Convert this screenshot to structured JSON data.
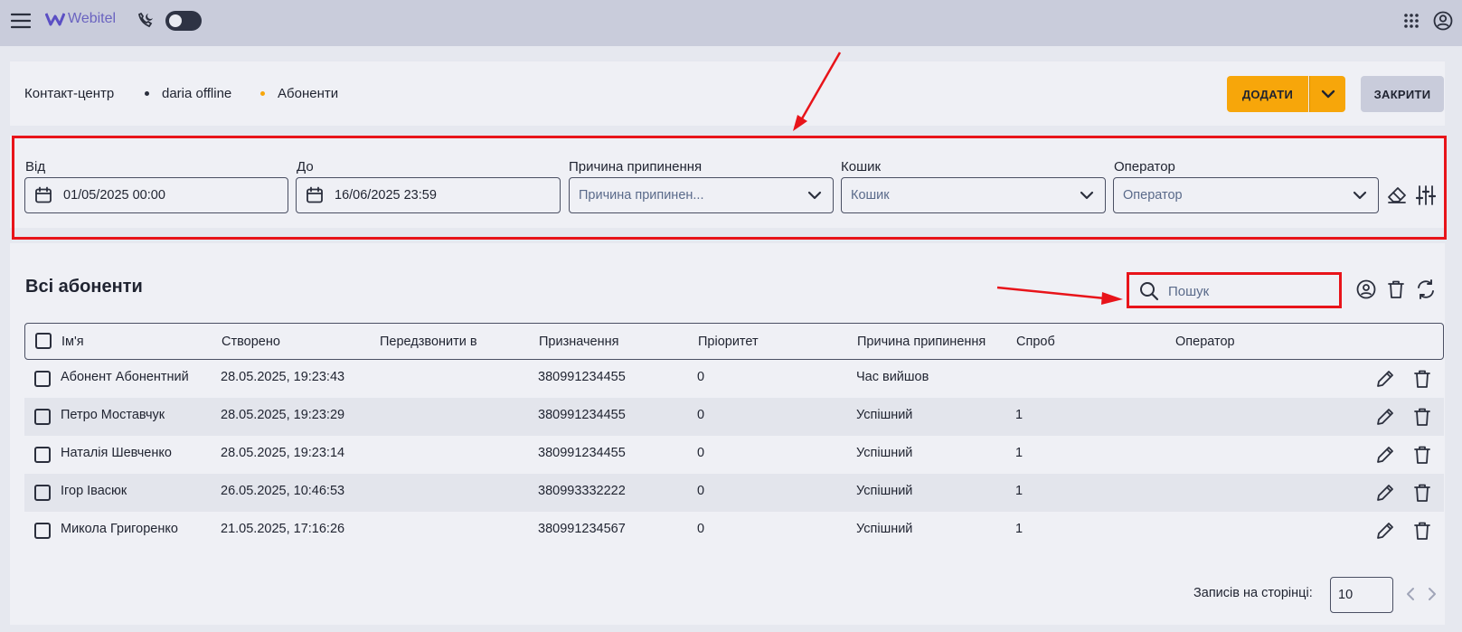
{
  "app": {
    "logo_text": "Webitel"
  },
  "breadcrumb": {
    "items": [
      "Контакт-центр",
      "daria offline",
      "Абоненти"
    ]
  },
  "actions": {
    "add_label": "ДОДАТИ",
    "close_label": "ЗАКРИТИ"
  },
  "filters": {
    "from": {
      "label": "Від",
      "value": "01/05/2025 00:00"
    },
    "to": {
      "label": "До",
      "value": "16/06/2025 23:59"
    },
    "reason": {
      "label": "Причина припинення",
      "placeholder": "Причина припинен..."
    },
    "bucket": {
      "label": "Кошик",
      "placeholder": "Кошик"
    },
    "operator": {
      "label": "Оператор",
      "placeholder": "Оператор"
    }
  },
  "table": {
    "title": "Всі абоненти",
    "search_placeholder": "Пошук",
    "columns": [
      "Ім'я",
      "Створено",
      "Передзвонити в",
      "Призначення",
      "Пріоритет",
      "Причина припинення",
      "Спроб",
      "Оператор"
    ],
    "rows": [
      {
        "name": "Абонент Абонентний",
        "created": "28.05.2025, 19:23:43",
        "callback": "",
        "destination": "380991234455",
        "priority": "0",
        "reason": "Час вийшов",
        "attempts": "",
        "operator": ""
      },
      {
        "name": "Петро Моставчук",
        "created": "28.05.2025, 19:23:29",
        "callback": "",
        "destination": "380991234455",
        "priority": "0",
        "reason": "Успішний",
        "attempts": "1",
        "operator": ""
      },
      {
        "name": "Наталія Шевченко",
        "created": "28.05.2025, 19:23:14",
        "callback": "",
        "destination": "380991234455",
        "priority": "0",
        "reason": "Успішний",
        "attempts": "1",
        "operator": ""
      },
      {
        "name": "Ігор Івасюк",
        "created": "26.05.2025, 10:46:53",
        "callback": "",
        "destination": "380993332222",
        "priority": "0",
        "reason": "Успішний",
        "attempts": "1",
        "operator": ""
      },
      {
        "name": "Микола Григоренко",
        "created": "21.05.2025, 17:16:26",
        "callback": "",
        "destination": "380991234567",
        "priority": "0",
        "reason": "Успішний",
        "attempts": "1",
        "operator": ""
      }
    ]
  },
  "pagination": {
    "per_page_label": "Записів на сторінці:",
    "per_page_value": "10"
  },
  "colors": {
    "accent": "#f7a60a",
    "annotation": "#e8141a",
    "topbar": "#c9ccdb"
  }
}
